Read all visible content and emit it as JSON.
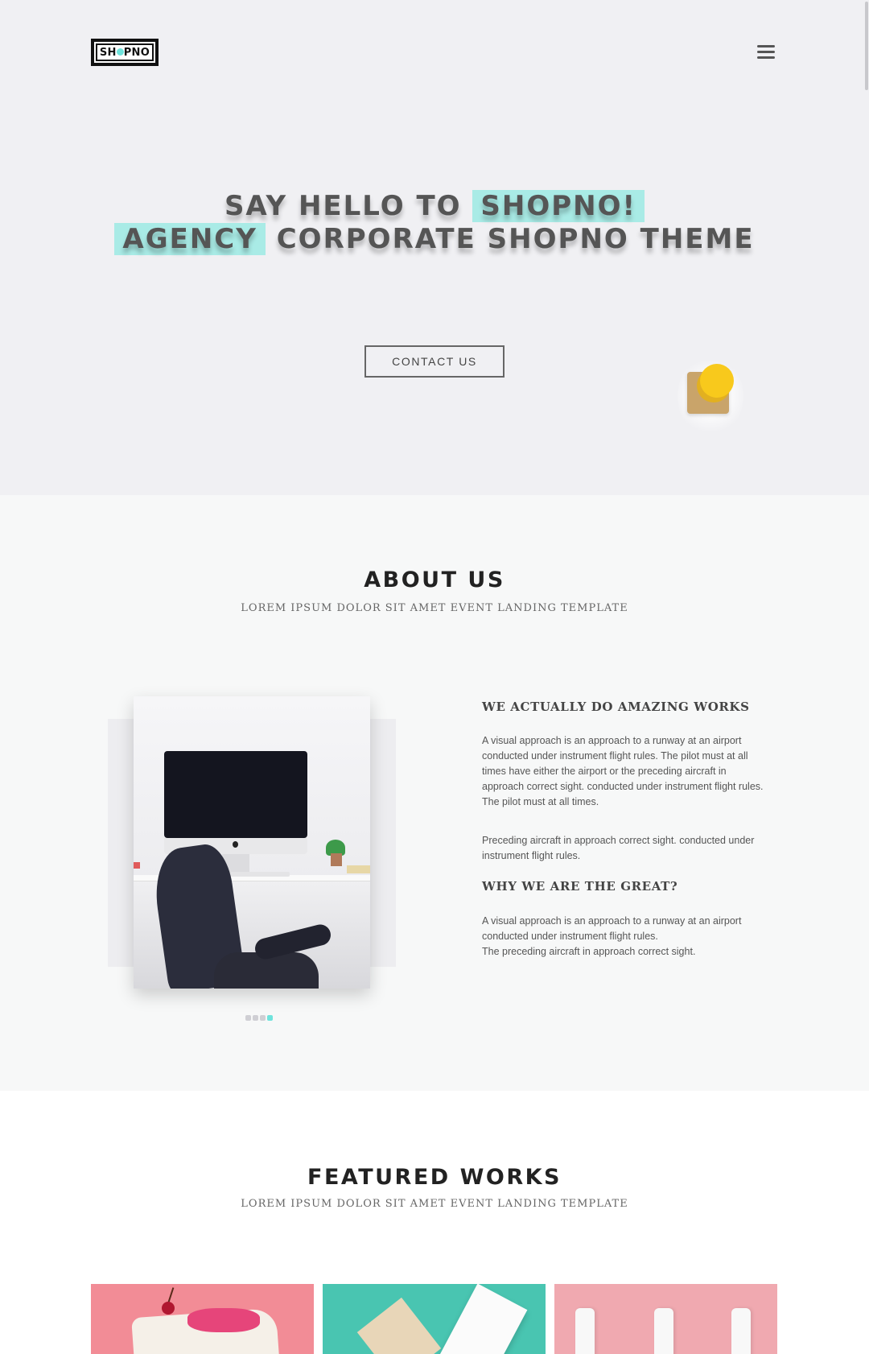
{
  "header": {
    "logo_text_left": "SH",
    "logo_text_right": "PNO",
    "menu_icon": "hamburger-icon"
  },
  "hero": {
    "line1_plain": "SAY HELLO TO",
    "line1_highlight": "SHOPNO!",
    "line2_highlight": "AGENCY",
    "line2_plain": "CORPORATE SHOPNO THEME",
    "cta_label": "CONTACT US",
    "highlight_color": "#a9ebe6"
  },
  "about": {
    "title": "ABOUT US",
    "subtitle": "LOREM IPSUM DOLOR SIT AMET EVENT LANDING TEMPLATE",
    "heading1": "WE ACTUALLY DO AMAZING WORKS",
    "para1": "A visual approach is an approach to a runway at an airport conducted under instrument flight rules. The pilot must at all times have either the airport or the preceding aircraft in approach correct sight. conducted under instrument flight rules. The pilot must at all times.",
    "para2": "Preceding aircraft in approach correct sight. conducted under instrument flight rules.",
    "heading2": "WHY WE ARE THE GREAT?",
    "para3_line1": "A visual approach is an approach to a runway at an airport conducted under instrument flight rules.",
    "para3_line2": "The preceding aircraft in approach correct sight.",
    "slider_dots": 4,
    "slider_active_index": 3
  },
  "featured": {
    "title": "FEATURED WORKS",
    "subtitle": "LOREM IPSUM DOLOR SIT AMET EVENT LANDING TEMPLATE",
    "works": [
      {
        "color": "#f28c96"
      },
      {
        "color": "#49c5b1"
      },
      {
        "color": "#f0a9b0"
      }
    ]
  },
  "colors": {
    "accent": "#6fe3dc",
    "hero_bg": "#f0f0f3",
    "about_bg": "#f7f8f8"
  }
}
